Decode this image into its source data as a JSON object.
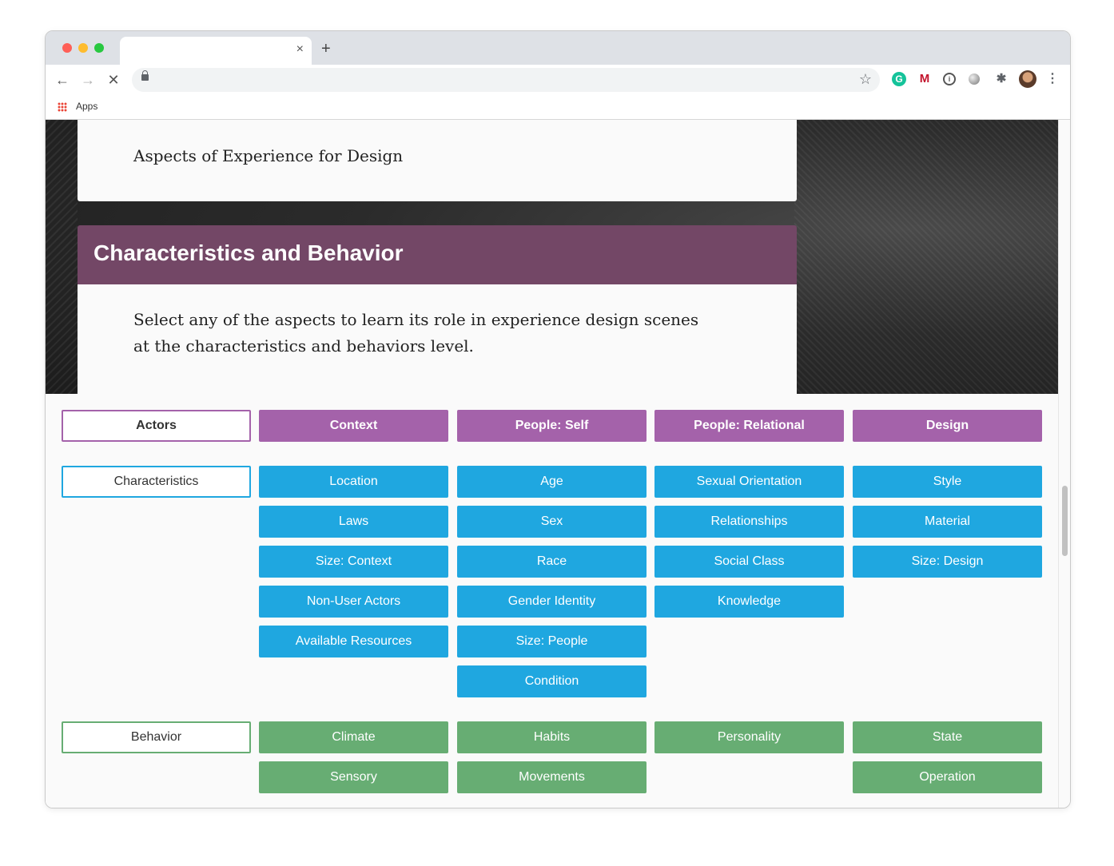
{
  "browser": {
    "tab_close": "×",
    "new_tab": "+",
    "bookmarks": {
      "apps_label": "Apps"
    }
  },
  "page": {
    "top_card_text": "Aspects of Experience for Design",
    "section_title": "Characteristics and Behavior",
    "section_body": "Select any of the aspects to learn its role in experience design scenes at the characteristics and behaviors level."
  },
  "grid": {
    "headers": [
      "Actors",
      "Context",
      "People: Self",
      "People: Relational",
      "Design"
    ],
    "characteristics_label": "Characteristics",
    "characteristics": [
      [
        "Location",
        "Laws",
        "Size: Context",
        "Non-User Actors",
        "Available Resources"
      ],
      [
        "Age",
        "Sex",
        "Race",
        "Gender Identity",
        "Size: People",
        "Condition"
      ],
      [
        "Sexual Orientation",
        "Relationships",
        "Social Class",
        "Knowledge"
      ],
      [
        "Style",
        "Material",
        "Size: Design"
      ]
    ],
    "behavior_label": "Behavior",
    "behavior": [
      [
        "Climate",
        "Sensory"
      ],
      [
        "Habits",
        "Movements"
      ],
      [
        "Personality"
      ],
      [
        "State",
        "Operation"
      ]
    ]
  },
  "colors": {
    "header_purple": "#734766",
    "button_purple": "#a462aa",
    "button_blue": "#1fa7e0",
    "button_green": "#67ad73"
  }
}
